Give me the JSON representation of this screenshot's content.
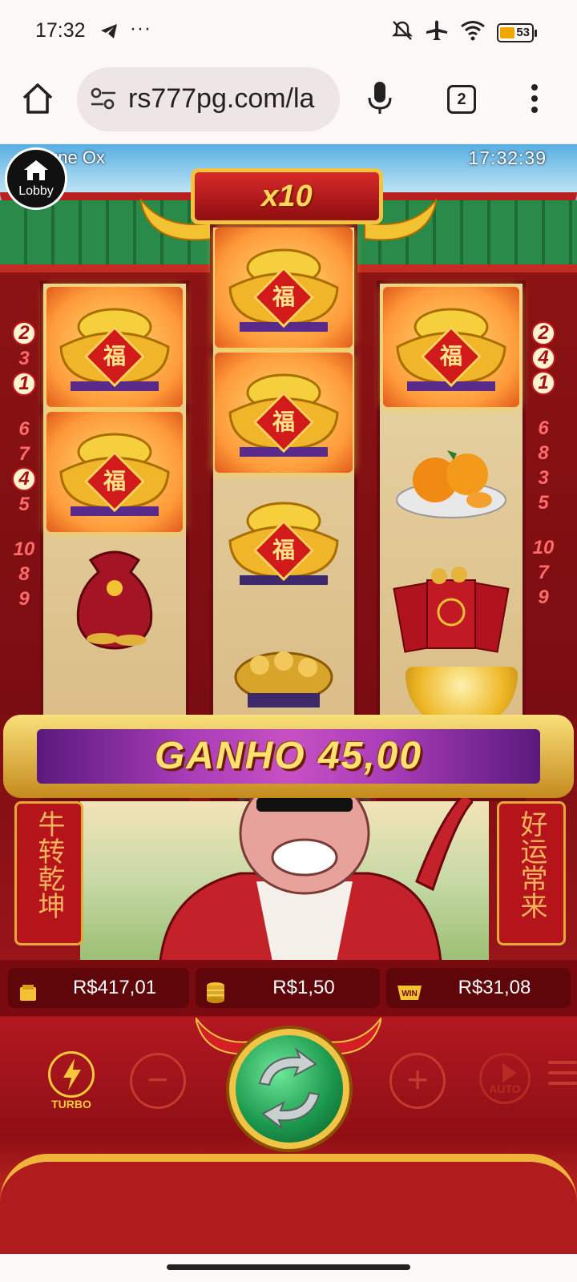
{
  "status_bar": {
    "time": "17:32",
    "more": "···",
    "battery": "53",
    "icons": [
      "telegram-icon",
      "mute-icon",
      "airplane-icon",
      "wifi-icon",
      "battery-icon"
    ]
  },
  "browser": {
    "url": "rs777pg.com/la",
    "tab_count": "2"
  },
  "game": {
    "name": "une Ox",
    "clock": "17:32:39",
    "lobby_label": "Lobby",
    "multiplier": "x10",
    "win_banner": "GANHO 45,00",
    "fu_char": "福",
    "paylines_left": [
      {
        "n": "2",
        "on": true
      },
      {
        "n": "3",
        "on": false
      },
      {
        "n": "1",
        "on": true
      },
      {
        "n": "6",
        "on": false
      },
      {
        "n": "7",
        "on": false
      },
      {
        "n": "4",
        "on": true
      },
      {
        "n": "5",
        "on": false
      },
      {
        "n": "10",
        "on": false
      },
      {
        "n": "8",
        "on": false
      },
      {
        "n": "9",
        "on": false
      }
    ],
    "paylines_right": [
      {
        "n": "2",
        "on": true
      },
      {
        "n": "4",
        "on": true
      },
      {
        "n": "1",
        "on": true
      },
      {
        "n": "6",
        "on": false
      },
      {
        "n": "8",
        "on": false
      },
      {
        "n": "3",
        "on": false
      },
      {
        "n": "5",
        "on": false
      },
      {
        "n": "10",
        "on": false
      },
      {
        "n": "7",
        "on": false
      },
      {
        "n": "9",
        "on": false
      }
    ],
    "pillar_left": "牛转乾坤",
    "pillar_right": "好运常来",
    "balance": "R$417,01",
    "bet": "R$1,50",
    "win": "R$31,08",
    "win_icon_label": "WIN",
    "turbo_label": "TURBO",
    "auto_label": "AUTO",
    "minus_label": "−",
    "plus_label": "+"
  }
}
